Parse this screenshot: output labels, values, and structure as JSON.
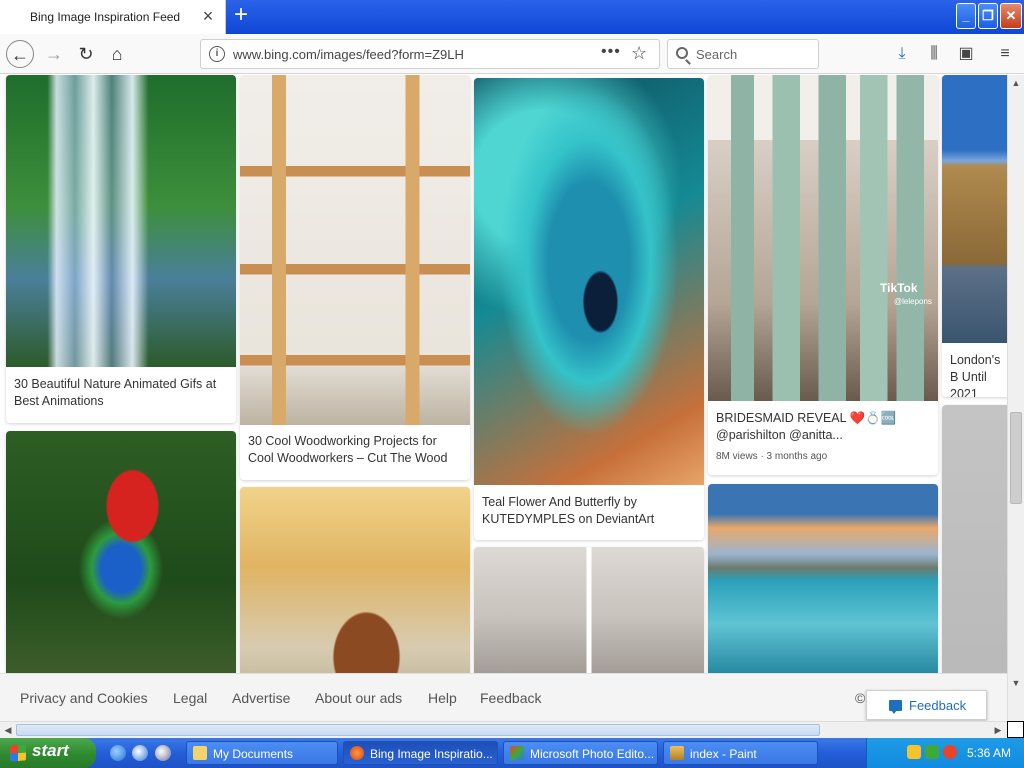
{
  "browser": {
    "tab_title": "Bing Image Inspiration Feed",
    "url": "www.bing.com/images/feed?form=Z9LH",
    "search_placeholder": "Search"
  },
  "feed": {
    "cards": [
      {
        "id": "waterfall",
        "caption": "30 Beautiful Nature Animated Gifs at Best Animations"
      },
      {
        "id": "shelf",
        "caption": "30 Cool Woodworking Projects for Cool Woodworkers – Cut The Wood"
      },
      {
        "id": "butterfly",
        "caption": "Teal Flower And Butterfly by KUTEDYMPLES on DeviantArt"
      },
      {
        "id": "brides",
        "caption": "BRIDESMAID REVEAL ❤️💍🆒 @parishilton @anitta...",
        "meta": "8M views · 3 months ago",
        "watermark": "TikTok",
        "handle": "@lelepons"
      },
      {
        "id": "london",
        "caption": "London's B Until 2021"
      },
      {
        "id": "parrot",
        "caption": ""
      },
      {
        "id": "horse",
        "caption": ""
      },
      {
        "id": "tiles",
        "caption": ""
      },
      {
        "id": "ocean",
        "caption": ""
      },
      {
        "id": "grey",
        "caption": ""
      }
    ]
  },
  "footer": {
    "links": [
      "Privacy and Cookies",
      "Legal",
      "Advertise",
      "About our ads",
      "Help",
      "Feedback"
    ],
    "copyright": "©",
    "feedback_button": "Feedback"
  },
  "taskbar": {
    "start_label": "start",
    "tasks": [
      {
        "label": "My Documents",
        "active": false
      },
      {
        "label": "Bing Image Inspiratio...",
        "active": true
      },
      {
        "label": "Microsoft Photo Edito...",
        "active": false
      },
      {
        "label": "index - Paint",
        "active": false
      }
    ],
    "clock": "5:36 AM"
  },
  "colors": {
    "accent": "#1f6fbf",
    "taskbar": "#245ed9",
    "start_green": "#2f8a2f"
  },
  "icons": [
    "back-arrow-icon",
    "forward-arrow-icon",
    "reload-icon",
    "home-icon",
    "info-icon",
    "more-dots-icon",
    "bookmark-star-icon",
    "search-icon",
    "download-icon",
    "library-icon",
    "sidebar-icon",
    "menu-icon",
    "close-icon",
    "new-tab-icon",
    "minimize-icon",
    "maximize-icon",
    "window-close-icon",
    "feedback-icon",
    "windows-flag-icon"
  ]
}
